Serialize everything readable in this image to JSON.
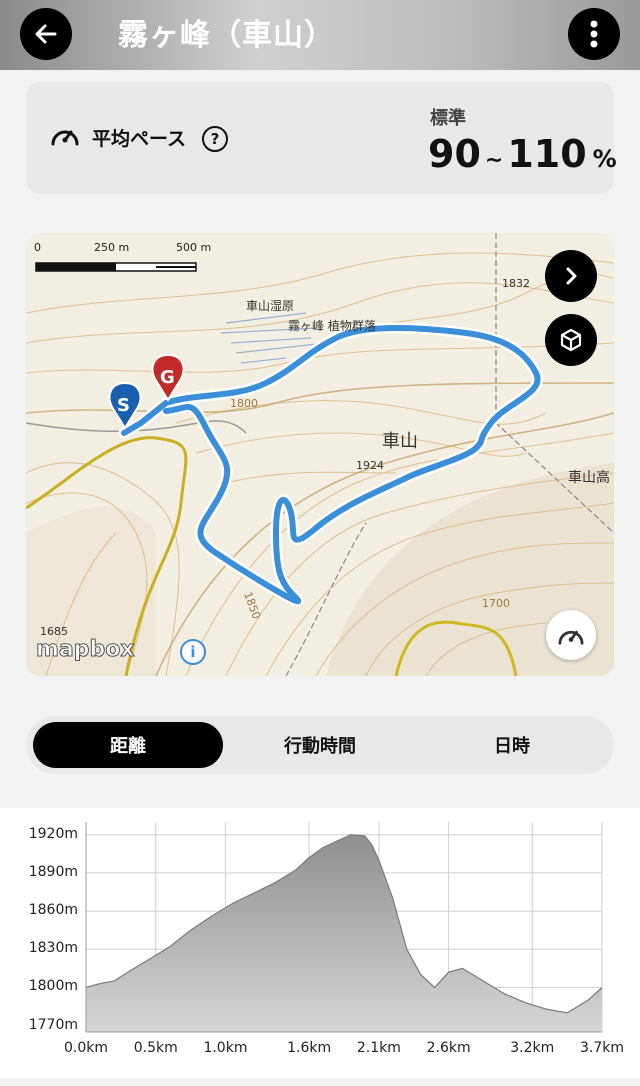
{
  "header": {
    "title": "霧ヶ峰（車山）"
  },
  "pace": {
    "label": "平均ペース",
    "standard_label": "標準",
    "min": "90",
    "tilde": "~",
    "max": "110",
    "unit": "%"
  },
  "map": {
    "scale_labels": [
      "0",
      "250 m",
      "500 m"
    ],
    "attribution": "mapbox",
    "place_labels": [
      "車山湿原",
      "霧ヶ峰 植物群落",
      "車山",
      "車山高",
      "1832",
      "1800",
      "1924",
      "1850",
      "1700",
      "1685"
    ],
    "start_marker": "S",
    "goal_marker": "G"
  },
  "tabs": [
    {
      "label": "距離",
      "active": true
    },
    {
      "label": "行動時間",
      "active": false
    },
    {
      "label": "日時",
      "active": false
    }
  ],
  "chart_data": {
    "type": "area",
    "xlabel": "",
    "ylabel": "",
    "x_ticks": [
      "0.0km",
      "0.5km",
      "1.0km",
      "1.6km",
      "2.1km",
      "2.6km",
      "3.2km",
      "3.7km"
    ],
    "y_ticks": [
      "1770m",
      "1800m",
      "1830m",
      "1860m",
      "1890m",
      "1920m"
    ],
    "xlim": [
      0,
      3.7
    ],
    "ylim": [
      1765,
      1930
    ],
    "grid": true,
    "x": [
      0.0,
      0.1,
      0.2,
      0.3,
      0.45,
      0.6,
      0.75,
      0.9,
      1.05,
      1.2,
      1.35,
      1.5,
      1.6,
      1.7,
      1.8,
      1.9,
      2.0,
      2.05,
      2.1,
      2.2,
      2.3,
      2.4,
      2.5,
      2.6,
      2.7,
      2.85,
      3.0,
      3.15,
      3.3,
      3.45,
      3.6,
      3.7
    ],
    "y": [
      1800,
      1803,
      1805,
      1812,
      1822,
      1832,
      1845,
      1856,
      1866,
      1874,
      1882,
      1892,
      1902,
      1910,
      1915,
      1920,
      1919,
      1912,
      1900,
      1870,
      1830,
      1810,
      1800,
      1812,
      1815,
      1805,
      1795,
      1788,
      1783,
      1780,
      1790,
      1800
    ]
  }
}
